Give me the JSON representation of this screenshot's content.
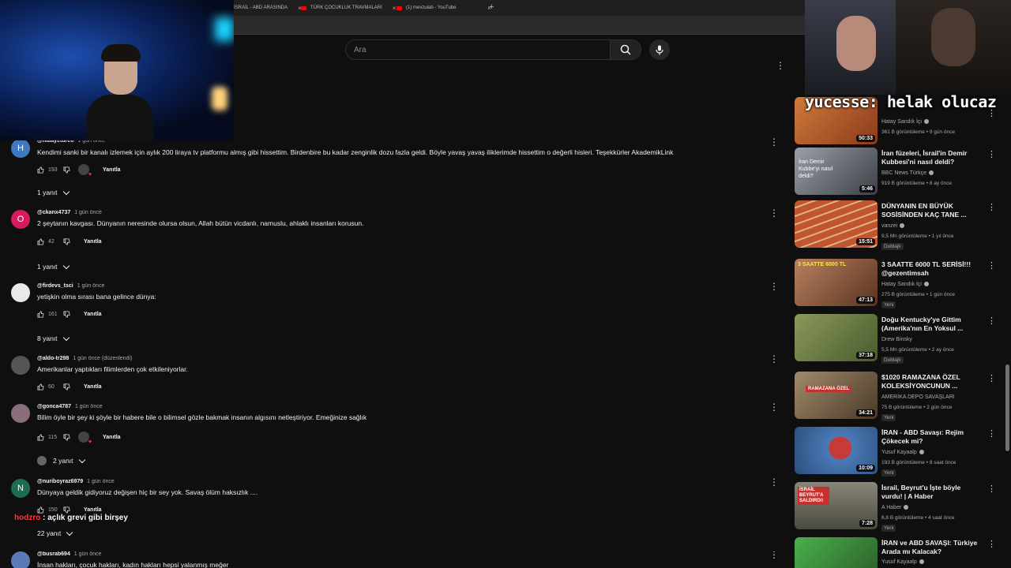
{
  "browser": {
    "tabs": [
      {
        "label": "İSRAİL - ABD ARASINDA"
      },
      {
        "label": "TÜRK ÇOCUKLUK TRAVMALARI"
      },
      {
        "label": "(1) mevzulab - YouTube"
      }
    ],
    "new_tab": "+",
    "close_glyph": "×"
  },
  "search": {
    "placeholder": "Ara"
  },
  "comments": [
    {
      "handle": "@hidayetdreo",
      "time": "1 gün önce",
      "text": "Kendimi sanki bir kanalı izlemek için aylık 200 liraya tv platformu almış gibi hissettim. Birdenbire bu kadar zenginlik dozu fazla geldi. Böyle yavaş yavaş iliklerimde hissettim o değerli hisleri. Teşekkürler AkademikLink",
      "likes": "193",
      "reply": "Yanıtla",
      "avatar_letter": "H",
      "avatar_color": "#3f79c2",
      "replies": "1 yanıt"
    },
    {
      "handle": "@ckanx4737",
      "time": "1 gün önce",
      "text": "2 şeytanın kavgası. Dünyanın neresinde olursa olsun, Allah bütün vicdanlı, namuslu, ahlaklı insanları korusun.",
      "likes": "42",
      "reply": "Yanıtla",
      "avatar_letter": "O",
      "avatar_color": "#d81b60",
      "replies": "1 yanıt"
    },
    {
      "handle": "@firdevs_tsci",
      "time": "1 gün önce",
      "text": "yetişkin olma sırası bana gelince dünya:",
      "likes": "161",
      "reply": "Yanıtla",
      "avatar_letter": "",
      "avatar_color": "#e9e9e9",
      "replies": "8 yanıt"
    },
    {
      "handle": "@aldo-tr298",
      "time": "1 gün önce (düzenlendi)",
      "text": "Amerikanlar yaptıkları filimlerden çok etkileniyorlar.",
      "likes": "60",
      "reply": "Yanıtla",
      "avatar_letter": "",
      "avatar_color": "#555555",
      "replies": ""
    },
    {
      "handle": "@gonca4787",
      "time": "1 gün önce",
      "text": "Bilim öyle bir şey ki şöyle bir habere bile o bilimsel gözle bakmak insanın algısını netleştiriyor. Emeğinize sağlık",
      "likes": "115",
      "reply": "Yanıtla",
      "avatar_letter": "",
      "avatar_color": "#8a6e7c",
      "replies": "2 yanıt"
    },
    {
      "handle": "@nuriboyraz6979",
      "time": "1 gün önce",
      "text": "Dünyaya geldik gidiyoruz değişen hiç bir sey yok. Savaş ölüm haksızlık ....",
      "likes": "150",
      "reply": "Yanıtla",
      "avatar_letter": "N",
      "avatar_color": "#1e6b52",
      "replies": "22 yanıt"
    },
    {
      "handle": "@busrab694",
      "time": "1 gün önce",
      "text": "İnsan hakları, çocuk hakları, kadın hakları hepsi yalanmış meğer",
      "likes": "",
      "reply": "",
      "avatar_letter": "",
      "avatar_color": "#5a7bb5",
      "replies": ""
    }
  ],
  "overlays": {
    "chat_top_user": "yucesse",
    "chat_top_msg": ": helak olucaz",
    "chat_bottom_user": "hodzro",
    "chat_bottom_msg": " : açlık grevi gibi birşey"
  },
  "recommendations": [
    {
      "title": "",
      "channel": "Hatay Sandık İçi",
      "meta": "361 B görüntüleme • 9 gün önce",
      "duration": "50:33",
      "badge": "",
      "thumb": "#b4552a"
    },
    {
      "title": "İran füzeleri, İsrail'in Demir Kubbesi'ni nasıl deldi?",
      "channel": "BBC News Türkçe",
      "meta": "919 B görüntüleme • 8 ay önce",
      "duration": "5:46",
      "badge": "",
      "thumb": "#6b6f78",
      "thumb_text": "İran Demir Kubbe'yi nasıl deldi?"
    },
    {
      "title": "DÜNYANIN EN BÜYÜK SOSİSİNDEN KAÇ TANE ...",
      "channel": "vanzei",
      "meta": "9,5 Mn görüntüleme • 1 yıl önce",
      "duration": "15:51",
      "badge": "Dublajlı",
      "thumb": "#c0552e"
    },
    {
      "title": "3 SAATTE 6000 TL SERİSİ!!! @gezentimsah",
      "channel": "Hatay Sandık İçi",
      "meta": "275 B görüntüleme • 1 gün önce",
      "duration": "47:13",
      "badge": "Yeni",
      "thumb": "#a0684a",
      "thumb_text": "3 SAATTE 6000 TL"
    },
    {
      "title": "Doğu Kentucky'ye Gittim (Amerika'nın En Yoksul ...",
      "channel": "Drew Binsky",
      "meta": "5,5 Mn görüntüleme • 2 ay önce",
      "duration": "37:18",
      "badge": "Dublajlı",
      "thumb": "#6d7a4a"
    },
    {
      "title": "$1020 RAMAZANA ÖZEL KOLEKSİYONCUNUN ...",
      "channel": "AMERİKA DEPO SAVAŞLARI",
      "meta": "75 B görüntüleme • 2 gün önce",
      "duration": "34:21",
      "badge": "Yeni",
      "thumb": "#8a6f4e",
      "thumb_text": "RAMAZANA ÖZEL"
    },
    {
      "title": "İRAN - ABD Savaşı: Rejim Çökecek mi?",
      "channel": "Yusuf Kayaalp",
      "meta": "193 B görüntüleme • 8 saat önce",
      "duration": "10:09",
      "badge": "Yeni",
      "thumb": "#3b6ea8"
    },
    {
      "title": "İsrail, Beyrut'u İşte böyle vurdu! | A Haber",
      "channel": "A Haber",
      "meta": "6,8 B görüntüleme • 4 saat önce",
      "duration": "7:28",
      "badge": "Yeni",
      "thumb": "#6f6a5e",
      "thumb_text": "İSRAİL BEYRUT'A SALDIRDI!"
    },
    {
      "title": "İRAN ve ABD SAVAŞI: Türkiye Arada mı Kalacak?",
      "channel": "Yusuf Kayaalp",
      "meta": "",
      "duration": "",
      "badge": "",
      "thumb": "#3e7a3a"
    }
  ]
}
